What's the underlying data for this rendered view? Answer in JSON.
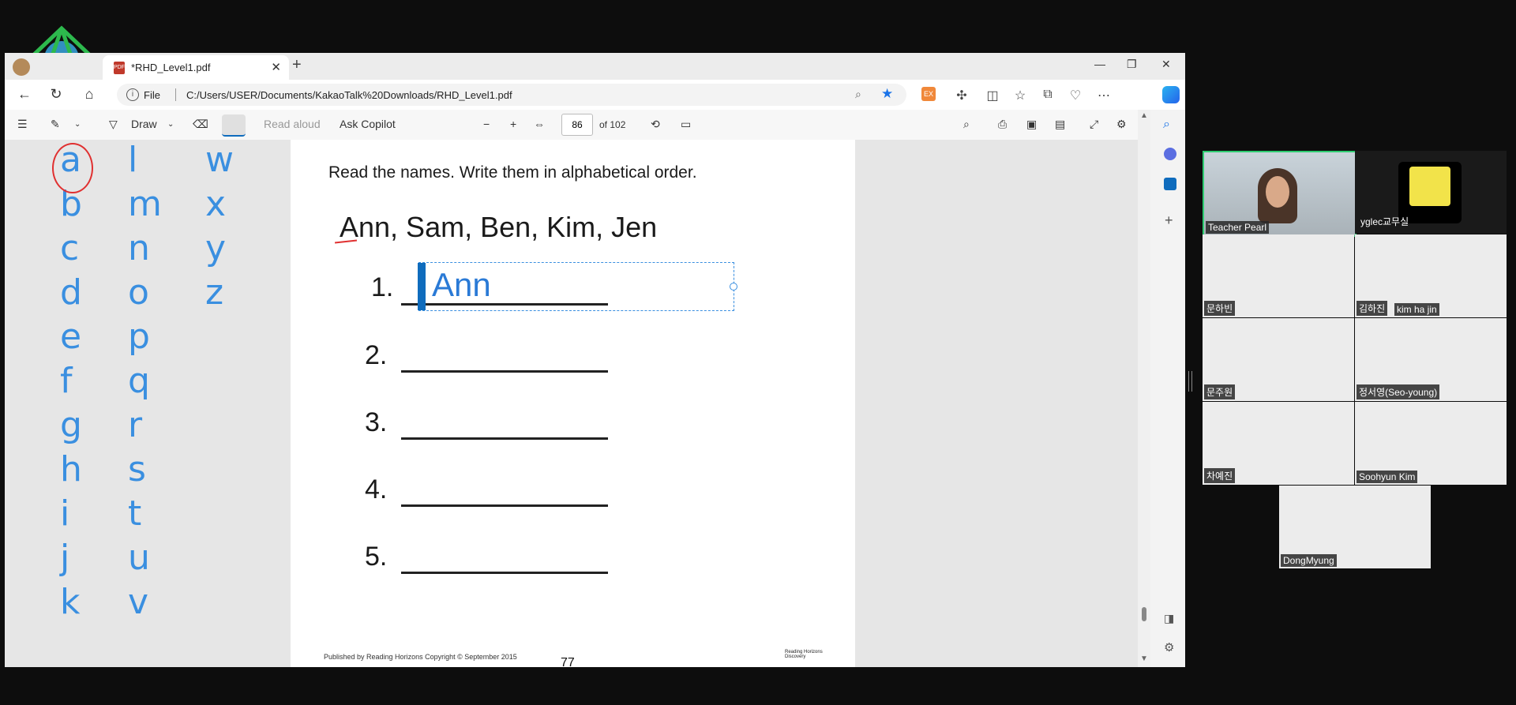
{
  "browser": {
    "tab_title": "*RHD_Level1.pdf",
    "file_label": "File",
    "url": "C:/Users/USER/Documents/KakaoTalk%20Downloads/RHD_Level1.pdf",
    "ext_label": "EX"
  },
  "pdf_toolbar": {
    "draw_label": "Draw",
    "read_aloud": "Read aloud",
    "ask_copilot": "Ask Copilot",
    "page_number": "86",
    "page_total": "of 102"
  },
  "worksheet": {
    "instruction": "Read the names. Write them in alphabetical order.",
    "names": "Ann, Sam, Ben, Kim, Jen",
    "items": [
      "1.",
      "2.",
      "3.",
      "4.",
      "5."
    ],
    "answer_1": "Ann",
    "footer": "Published by Reading Horizons Copyright © September 2015",
    "page_number": "77",
    "logo_text": "Reading Horizons Discovery"
  },
  "alphabet": {
    "col1": [
      "a",
      "b",
      "c",
      "d",
      "e",
      "f",
      "g",
      "h",
      "i",
      "j",
      "k"
    ],
    "col2": [
      "l",
      "m",
      "n",
      "o",
      "p",
      "q",
      "r",
      "s",
      "t",
      "u",
      "v"
    ],
    "col3": [
      "w",
      "x",
      "y",
      "z"
    ]
  },
  "participants": [
    "Teacher Pearl",
    "yglec교무실",
    "문하빈",
    "김하진",
    "kim ha jin",
    "문주원",
    "정서영(Seo-young)",
    "차예진",
    "Soohyun Kim",
    "DongMyung"
  ],
  "colors": {
    "accent": "#0f6cbd",
    "letters": "#3a8fe0",
    "active_speaker": "#2ecc71"
  }
}
